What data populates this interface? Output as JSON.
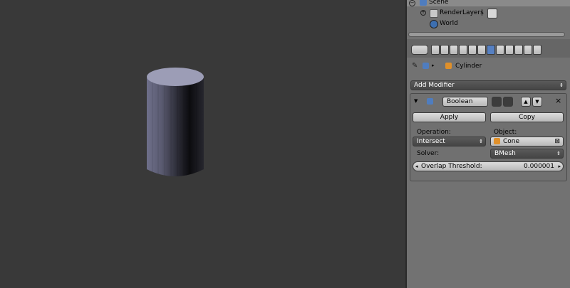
{
  "outliner": {
    "items": [
      {
        "label": "Scene"
      },
      {
        "label": "RenderLayers"
      },
      {
        "label": "World"
      }
    ]
  },
  "properties": {
    "context_object": "Cylinder",
    "add_modifier_label": "Add Modifier",
    "modifier": {
      "name": "Boolean",
      "apply_label": "Apply",
      "copy_label": "Copy",
      "operation_label": "Operation:",
      "operation_value": "Intersect",
      "object_label": "Object:",
      "object_value": "Cone",
      "solver_label": "Solver:",
      "solver_value": "BMesh",
      "overlap_label": "Overlap Threshold:",
      "overlap_value": "0.000001"
    }
  },
  "colors": {
    "viewport_bg": "#393939",
    "panel_bg": "#727272",
    "object_orange": "#e0902a",
    "active_tab": "#5680c2"
  }
}
